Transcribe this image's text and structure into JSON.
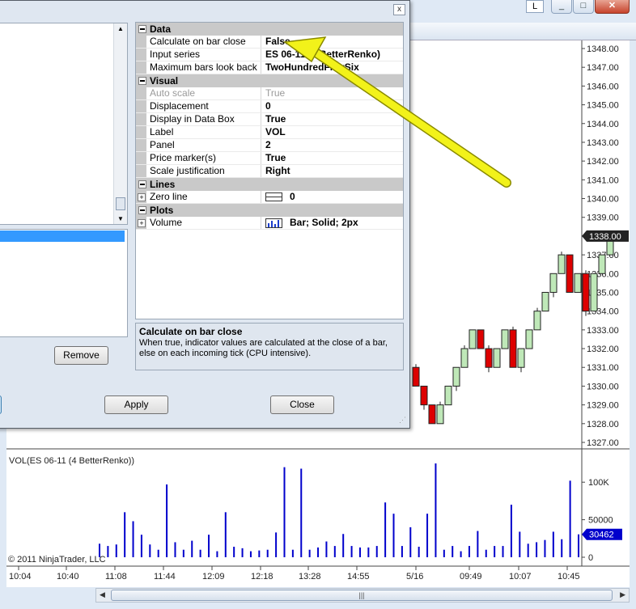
{
  "window": {
    "l_button": "L",
    "minimize": "_",
    "maximize": "□",
    "close": "✕"
  },
  "dialog": {
    "close": "x",
    "buttons": {
      "remove": "Remove",
      "apply": "Apply",
      "close": "Close"
    },
    "properties": [
      {
        "category": "Data",
        "rows": [
          {
            "name": "Calculate on bar close",
            "value": "False"
          },
          {
            "name": "Input series",
            "value": "ES 06-11 (4 BetterRenko)"
          },
          {
            "name": "Maximum bars look back",
            "value": "TwoHundredFiftySix"
          }
        ]
      },
      {
        "category": "Visual",
        "rows": [
          {
            "name": "Auto scale",
            "value": "True",
            "disabled": true
          },
          {
            "name": "Displacement",
            "value": "0"
          },
          {
            "name": "Display in Data Box",
            "value": "True"
          },
          {
            "name": "Label",
            "value": "VOL"
          },
          {
            "name": "Panel",
            "value": "2"
          },
          {
            "name": "Price marker(s)",
            "value": "True"
          },
          {
            "name": "Scale justification",
            "value": "Right"
          }
        ]
      },
      {
        "category": "Lines",
        "rows": [
          {
            "name": "Zero line",
            "value": "0",
            "icon": "line-icon",
            "expandable": true
          }
        ]
      },
      {
        "category": "Plots",
        "rows": [
          {
            "name": "Volume",
            "value": "Bar; Solid; 2px",
            "icon": "bar-plot-icon",
            "expandable": true
          }
        ]
      }
    ],
    "description": {
      "title": "Calculate on bar close",
      "text": "When true, indicator values are calculated at the close of a bar, else on each incoming tick (CPU intensive)."
    }
  },
  "chart": {
    "price_ticks": [
      "1348.00",
      "1347.00",
      "1346.00",
      "1345.00",
      "1344.00",
      "1343.00",
      "1342.00",
      "1341.00",
      "1340.00",
      "1339.00",
      "1338.00",
      "1337.00",
      "1336.00",
      "1335.00",
      "1334.00",
      "1333.00",
      "1332.00",
      "1331.00",
      "1330.00",
      "1329.00",
      "1328.00",
      "1327.00"
    ],
    "last_price": "1338.00",
    "volume_label": "VOL(ES 06-11 (4 BetterRenko))",
    "volume_ticks": [
      "100K",
      "50000",
      "0"
    ],
    "last_volume": "30462",
    "copyright": "© 2011 NinjaTrader, LLC",
    "time_ticks": [
      "10:04",
      "10:40",
      "11:08",
      "11:44",
      "12:09",
      "12:18",
      "13:28",
      "14:55",
      "5/16",
      "09:49",
      "10:07",
      "10:45"
    ],
    "colors": {
      "up": "#bfe8b8",
      "down": "#dd0000",
      "volume": "#0000cc",
      "marker": "#0000cc",
      "arrow": "#f2f21a"
    }
  },
  "chart_data": {
    "type": "bar",
    "candles_renko": [
      {
        "open": 1331,
        "close": 1330,
        "dir": "down"
      },
      {
        "open": 1330,
        "close": 1329,
        "dir": "down"
      },
      {
        "open": 1329,
        "close": 1328,
        "dir": "down"
      },
      {
        "open": 1328,
        "close": 1329,
        "dir": "up"
      },
      {
        "open": 1329,
        "close": 1330,
        "dir": "up"
      },
      {
        "open": 1330,
        "close": 1331,
        "dir": "up"
      },
      {
        "open": 1331,
        "close": 1332,
        "dir": "up"
      },
      {
        "open": 1332,
        "close": 1333,
        "dir": "up"
      },
      {
        "open": 1333,
        "close": 1332,
        "dir": "down"
      },
      {
        "open": 1332,
        "close": 1331,
        "dir": "down"
      },
      {
        "open": 1331,
        "close": 1332,
        "dir": "up"
      },
      {
        "open": 1332,
        "close": 1333,
        "dir": "up"
      },
      {
        "open": 1333,
        "close": 1331,
        "dir": "down"
      },
      {
        "open": 1331,
        "close": 1332,
        "dir": "up"
      },
      {
        "open": 1332,
        "close": 1333,
        "dir": "up"
      },
      {
        "open": 1333,
        "close": 1334,
        "dir": "up"
      },
      {
        "open": 1334,
        "close": 1335,
        "dir": "up"
      },
      {
        "open": 1335,
        "close": 1336,
        "dir": "up"
      },
      {
        "open": 1336,
        "close": 1337,
        "dir": "up"
      },
      {
        "open": 1337,
        "close": 1335,
        "dir": "down"
      },
      {
        "open": 1335,
        "close": 1336,
        "dir": "up"
      },
      {
        "open": 1336,
        "close": 1334,
        "dir": "down"
      },
      {
        "open": 1334,
        "close": 1336,
        "dir": "up"
      },
      {
        "open": 1336,
        "close": 1337,
        "dir": "up"
      },
      {
        "open": 1337,
        "close": 1338,
        "dir": "up"
      }
    ],
    "volume": [
      18000,
      15000,
      17000,
      60000,
      48000,
      30000,
      17000,
      10000,
      97000,
      20000,
      10000,
      22000,
      10000,
      30000,
      8000,
      60000,
      14000,
      12000,
      8000,
      9000,
      10000,
      33000,
      120000,
      10000,
      118000,
      10000,
      13000,
      21000,
      15000,
      31000,
      15000,
      13000,
      13000,
      15000,
      73000,
      58000,
      15000,
      40000,
      14000,
      58000,
      125000,
      10000,
      15000,
      8000,
      15000,
      35000,
      10000,
      15000,
      15000,
      70000,
      34000,
      18000,
      20000,
      23000,
      34000,
      24000,
      102000,
      30462
    ],
    "ylim_price": [
      1327,
      1348
    ],
    "ylim_volume": [
      0,
      125000
    ]
  }
}
